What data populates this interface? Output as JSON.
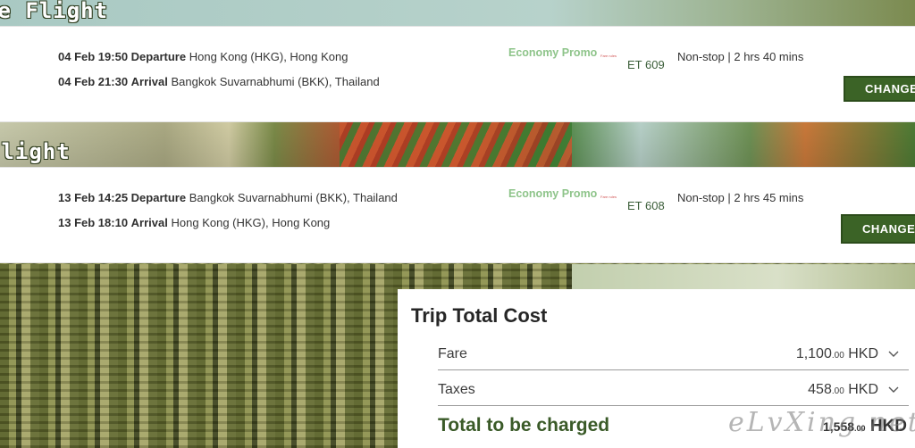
{
  "outbound": {
    "section_title": "re Flight",
    "departure": {
      "datetime": "04 Feb 19:50",
      "label": "Departure",
      "place": "Hong Kong (HKG), Hong Kong"
    },
    "arrival": {
      "datetime": "04 Feb 21:30",
      "label": "Arrival",
      "place": "Bangkok Suvarnabhumi (BKK), Thailand"
    },
    "fare_class": "Economy Promo",
    "fare_sub": "Fare rules",
    "flight_number": "ET 609",
    "stops_duration": "Non-stop | 2 hrs 40 mins",
    "change_label": "CHANGE"
  },
  "return": {
    "section_title": "Flight",
    "departure": {
      "datetime": "13 Feb 14:25",
      "label": "Departure",
      "place": "Bangkok Suvarnabhumi (BKK), Thailand"
    },
    "arrival": {
      "datetime": "13 Feb 18:10",
      "label": "Arrival",
      "place": "Hong Kong (HKG), Hong Kong"
    },
    "fare_class": "Economy Promo",
    "fare_sub": "Fare rules",
    "flight_number": "ET 608",
    "stops_duration": "Non-stop | 2 hrs 45 mins",
    "change_label": "CHANGE"
  },
  "trip_cost": {
    "title": "Trip Total Cost",
    "fare": {
      "label": "Fare",
      "amount": "1,100",
      "decimals": ".00",
      "currency": "HKD"
    },
    "taxes": {
      "label": "Taxes",
      "amount": "458",
      "decimals": ".00",
      "currency": "HKD"
    },
    "total": {
      "label": "Total to be charged",
      "amount": "1,558",
      "decimals": ".00",
      "currency": "HKD"
    }
  },
  "watermark": "eLvXing.net",
  "colors": {
    "accent_green": "#3b6326",
    "fare_class_green": "#8ec48a",
    "flight_number_green": "#3a5d38",
    "total_label_green": "#3a5a28"
  }
}
